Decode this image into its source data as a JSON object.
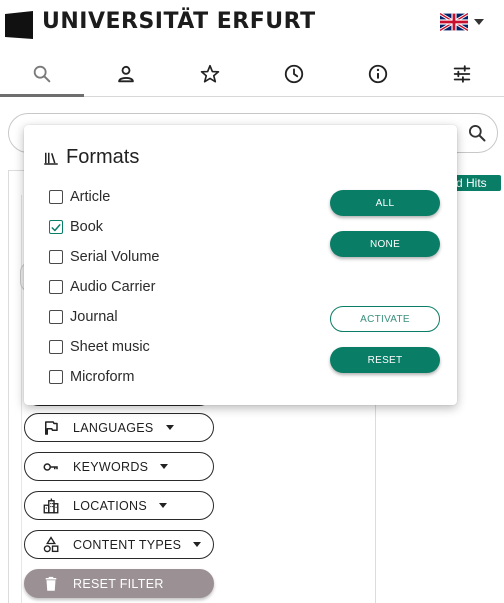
{
  "header": {
    "logo_text": "UNIVERSITÄT ERFURT",
    "language_flag": "uk-flag-icon"
  },
  "tabs": [
    {
      "icon": "search-icon",
      "active": true
    },
    {
      "icon": "person-icon",
      "active": false
    },
    {
      "icon": "star-icon",
      "active": false
    },
    {
      "icon": "clock-icon",
      "active": false
    },
    {
      "icon": "info-icon",
      "active": false
    },
    {
      "icon": "tune-icon",
      "active": false
    }
  ],
  "hits_badge": "sd Hits",
  "popup": {
    "title": "Formats",
    "options": [
      {
        "label": "Article",
        "checked": false
      },
      {
        "label": "Book",
        "checked": true
      },
      {
        "label": "Serial Volume",
        "checked": false
      },
      {
        "label": "Audio Carrier",
        "checked": false
      },
      {
        "label": "Journal",
        "checked": false
      },
      {
        "label": "Sheet music",
        "checked": false
      },
      {
        "label": "Microform",
        "checked": false
      }
    ],
    "buttons": {
      "all": "ALL",
      "none": "NONE",
      "activate": "ACTIVATE",
      "reset": "RESET"
    }
  },
  "filters": {
    "languages": "LANGUAGES",
    "keywords": "KEYWORDS",
    "locations": "LOCATIONS",
    "content_types": "CONTENT TYPES",
    "reset_filter": "RESET FILTER"
  },
  "colors": {
    "accent": "#0a7d66",
    "reset_filter_bg": "#9b9094"
  }
}
